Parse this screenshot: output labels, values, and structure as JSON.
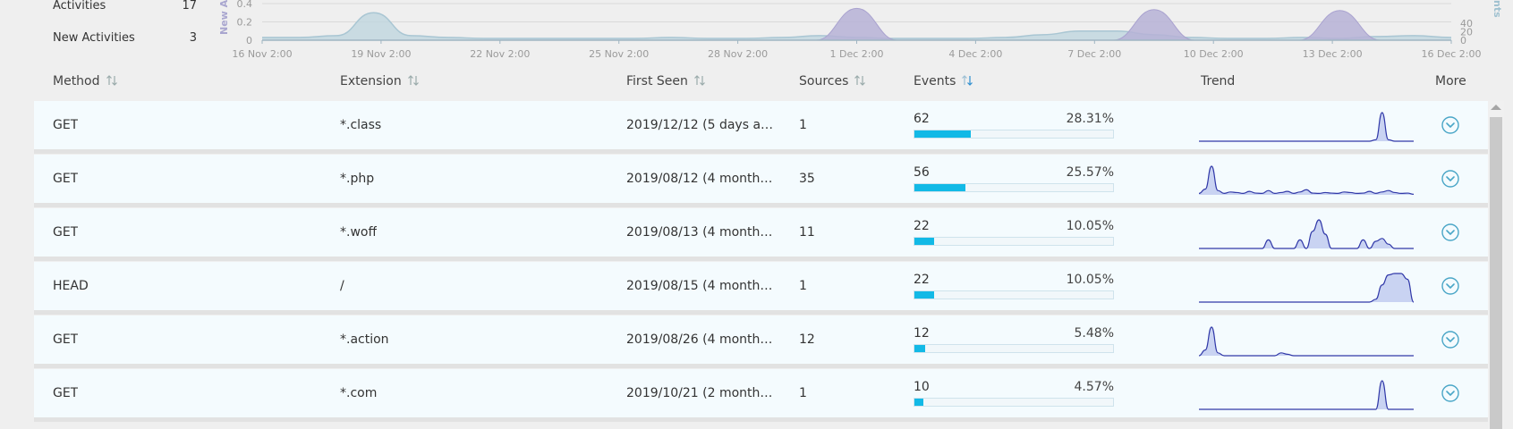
{
  "stats": [
    {
      "label": "Activities",
      "value": "17"
    },
    {
      "label": "New Activities",
      "value": "3"
    }
  ],
  "chart_data": {
    "type": "area",
    "y_left_label": "New A",
    "y_left_ticks": [
      "0.4",
      "0.2",
      "0"
    ],
    "y_right_label": "nts",
    "y_right_ticks": [
      "40",
      "20",
      "0"
    ],
    "x_tick_labels": [
      "16 Nov 2:00",
      "19 Nov 2:00",
      "22 Nov 2:00",
      "25 Nov 2:00",
      "28 Nov 2:00",
      "1 Dec 2:00",
      "4 Dec 2:00",
      "7 Dec 2:00",
      "10 Dec 2:00",
      "13 Dec 2:00",
      "16 Dec 2:00"
    ],
    "series": [
      {
        "values_by_day": [
          0.03,
          0.03,
          0.05,
          0.3,
          0.05,
          0.03,
          0.02,
          0.02,
          0.02,
          0.02,
          0.02,
          0.03,
          0.02,
          0.02,
          0.03,
          0.05,
          0.03,
          0.02,
          0.02,
          0.02,
          0.03,
          0.06,
          0.1,
          0.1,
          0.06,
          0.03,
          0.02,
          0.02,
          0.03,
          0.02,
          0.04,
          0.05,
          0.03
        ]
      },
      {
        "values_by_day": [
          0,
          0,
          0,
          0,
          0,
          0,
          0,
          0,
          0,
          0,
          0,
          0,
          0,
          0,
          0,
          0,
          75,
          0,
          0,
          0,
          0,
          0,
          0,
          0,
          72,
          0,
          0,
          0,
          0,
          70,
          0,
          0,
          0
        ]
      }
    ]
  },
  "table": {
    "columns": [
      "Method",
      "Extension",
      "First Seen",
      "Sources",
      "Events",
      "Trend",
      "More"
    ],
    "rows": [
      {
        "method": "GET",
        "extension": "*.class",
        "first_seen": "2019/12/12 (5 days ago)",
        "sources": "1",
        "events": "62",
        "percent": "28.31%",
        "fraction": 0.2831,
        "trend": [
          0,
          0,
          0,
          0,
          0,
          0,
          0,
          0,
          0,
          0,
          0,
          0,
          0,
          0,
          0,
          0,
          0,
          0,
          0,
          0,
          0,
          0,
          0,
          0,
          0,
          0,
          0,
          0,
          0.05,
          1,
          0.05,
          0,
          0,
          0,
          0
        ]
      },
      {
        "method": "GET",
        "extension": "*.php",
        "first_seen": "2019/08/12 (4 months ...",
        "sources": "35",
        "events": "56",
        "percent": "25.57%",
        "fraction": 0.2557,
        "trend": [
          0.05,
          0.2,
          1,
          0.15,
          0.05,
          0.1,
          0.08,
          0.05,
          0.12,
          0.06,
          0.05,
          0.15,
          0.05,
          0.08,
          0.12,
          0.05,
          0.1,
          0.18,
          0.06,
          0.05,
          0.08,
          0.06,
          0.05,
          0.1,
          0.08,
          0.05,
          0.06,
          0.12,
          0.05,
          0.1,
          0.15,
          0.08,
          0.05,
          0.06,
          0.02
        ]
      },
      {
        "method": "GET",
        "extension": "*.woff",
        "first_seen": "2019/08/13 (4 months ...",
        "sources": "11",
        "events": "22",
        "percent": "10.05%",
        "fraction": 0.1005,
        "trend": [
          0,
          0,
          0,
          0,
          0,
          0,
          0,
          0,
          0,
          0,
          0,
          0.3,
          0,
          0,
          0,
          0,
          0.3,
          0,
          0.6,
          1,
          0.5,
          0,
          0,
          0,
          0,
          0,
          0.3,
          0,
          0.25,
          0.35,
          0.15,
          0,
          0,
          0,
          0
        ]
      },
      {
        "method": "HEAD",
        "extension": "/",
        "first_seen": "2019/08/15 (4 months ...",
        "sources": "1",
        "events": "22",
        "percent": "10.05%",
        "fraction": 0.1005,
        "trend": [
          0,
          0,
          0,
          0,
          0,
          0,
          0,
          0,
          0,
          0,
          0,
          0,
          0,
          0,
          0,
          0,
          0,
          0,
          0,
          0,
          0,
          0,
          0,
          0,
          0,
          0,
          0,
          0,
          0.1,
          0.6,
          0.95,
          1,
          1,
          0.8,
          0
        ]
      },
      {
        "method": "GET",
        "extension": "*.action",
        "first_seen": "2019/08/26 (4 months ...",
        "sources": "12",
        "events": "12",
        "percent": "5.48%",
        "fraction": 0.0548,
        "trend": [
          0,
          0.2,
          1,
          0.1,
          0,
          0,
          0,
          0,
          0,
          0,
          0,
          0,
          0,
          0.1,
          0.05,
          0,
          0,
          0,
          0,
          0,
          0,
          0,
          0,
          0,
          0,
          0,
          0,
          0,
          0,
          0,
          0,
          0,
          0,
          0,
          0
        ]
      },
      {
        "method": "GET",
        "extension": "*.com",
        "first_seen": "2019/10/21 (2 months a...",
        "sources": "1",
        "events": "10",
        "percent": "4.57%",
        "fraction": 0.0457,
        "trend": [
          0,
          0,
          0,
          0,
          0,
          0,
          0,
          0,
          0,
          0,
          0,
          0,
          0,
          0,
          0,
          0,
          0,
          0,
          0,
          0,
          0,
          0,
          0,
          0,
          0,
          0,
          0,
          0,
          0,
          1,
          0,
          0,
          0,
          0,
          0
        ]
      }
    ]
  },
  "colors": {
    "accent": "#12b9e6",
    "trend_line": "#3038a8",
    "trend_fill": "#c9d3f2",
    "chart_purple": "#b6b1d6",
    "chart_blue": "#bcd4de"
  },
  "icons": {
    "sort": "sort-arrows-icon",
    "more": "chevron-down-circle-icon"
  }
}
